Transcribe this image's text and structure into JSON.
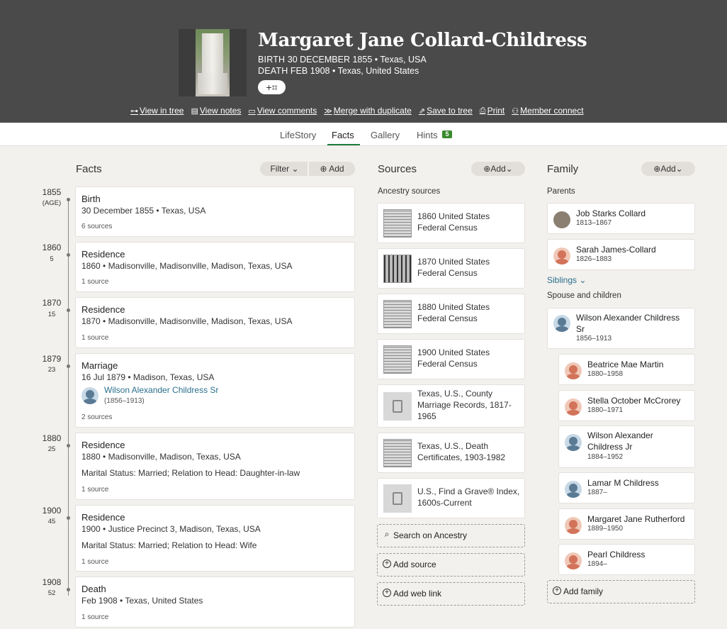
{
  "person": {
    "name": "Margaret Jane Collard-Childress",
    "birth_label": "BIRTH",
    "birth_value": "30 DECEMBER 1855 • Texas, USA",
    "death_label": "DEATH",
    "death_value": "FEB 1908 • Texas, United States",
    "tag_button": "+⌗"
  },
  "actions": [
    {
      "icon": "tree-icon",
      "glyph": "⊶",
      "label": "View in tree"
    },
    {
      "icon": "notes-icon",
      "glyph": "▤",
      "label": "View notes"
    },
    {
      "icon": "comments-icon",
      "glyph": "▭",
      "label": "View comments"
    },
    {
      "icon": "merge-icon",
      "glyph": "≫",
      "label": "Merge with duplicate"
    },
    {
      "icon": "save-icon",
      "glyph": "⇗",
      "label": "Save to tree"
    },
    {
      "icon": "print-icon",
      "glyph": "⎙",
      "label": "Print"
    },
    {
      "icon": "member-icon",
      "glyph": "⚇",
      "label": "Member connect"
    }
  ],
  "tabs": {
    "lifestory": "LifeStory",
    "facts": "Facts",
    "gallery": "Gallery",
    "hints": "Hints",
    "hints_count": "5"
  },
  "facts": {
    "heading": "Facts",
    "filter": "Filter",
    "add": "Add",
    "items": [
      {
        "year": "1855",
        "age": "(AGE)",
        "title": "Birth",
        "line1": "30 December 1855 • Texas, USA",
        "sources": "6 sources"
      },
      {
        "year": "1860",
        "age": "5",
        "title": "Residence",
        "line1": "1860 • Madisonville, Madisonville, Madison, Texas, USA",
        "sources": "1 source"
      },
      {
        "year": "1870",
        "age": "15",
        "title": "Residence",
        "line1": "1870 • Madisonville, Madisonville, Madison, Texas, USA",
        "sources": "1 source"
      },
      {
        "year": "1879",
        "age": "23",
        "title": "Marriage",
        "line1": "16 Jul 1879 • Madison, Texas, USA",
        "spouse": "Wilson Alexander Childress Sr",
        "spouse_dates": "(1856–1913)",
        "sources": "2 sources"
      },
      {
        "year": "1880",
        "age": "25",
        "title": "Residence",
        "line1": "1880 • Madisonville, Madison, Texas, USA",
        "line2": "Marital Status: Married; Relation to Head: Daughter-in-law",
        "sources": "1 source"
      },
      {
        "year": "1900",
        "age": "45",
        "title": "Residence",
        "line1": "1900 • Justice Precinct 3, Madison, Texas, USA",
        "line2": "Marital Status: Married; Relation to Head: Wife",
        "sources": "1 source"
      },
      {
        "year": "1908",
        "age": "52",
        "title": "Death",
        "line1": "Feb 1908 • Texas, United States",
        "sources": "1 source"
      }
    ]
  },
  "sources": {
    "heading": "Sources",
    "add": "Add",
    "subheading": "Ancestry sources",
    "items": [
      {
        "title": "1860 United States Federal Census"
      },
      {
        "title": "1870 United States Federal Census"
      },
      {
        "title": "1880 United States Federal Census"
      },
      {
        "title": "1900 United States Federal Census"
      },
      {
        "title": "Texas, U.S., County Marriage Records, 1817-1965"
      },
      {
        "title": "Texas, U.S., Death Certificates, 1903-1982"
      },
      {
        "title": "U.S., Find a Grave® Index, 1600s-Current"
      }
    ],
    "search": "Search on Ancestry",
    "add_source": "Add source",
    "add_web_link": "Add web link"
  },
  "family": {
    "heading": "Family",
    "add": "Add",
    "parents_label": "Parents",
    "parents": [
      {
        "name": "Job Starks Collard",
        "dates": "1813–1867"
      },
      {
        "name": "Sarah James-Collard",
        "dates": "1826–1883"
      }
    ],
    "siblings": "Siblings",
    "spouse_label": "Spouse and children",
    "spouse": {
      "name": "Wilson Alexander Childress Sr",
      "dates": "1856–1913"
    },
    "children": [
      {
        "name": "Beatrice Mae Martin",
        "dates": "1880–1958"
      },
      {
        "name": "Stella October McCrorey",
        "dates": "1880–1971"
      },
      {
        "name": "Wilson Alexander Childress Jr",
        "dates": "1884–1952"
      },
      {
        "name": "Lamar M Childress",
        "dates": "1887–"
      },
      {
        "name": "Margaret Jane Rutherford",
        "dates": "1889–1950"
      },
      {
        "name": "Pearl Childress",
        "dates": "1894–"
      }
    ],
    "add_family": "Add family"
  }
}
